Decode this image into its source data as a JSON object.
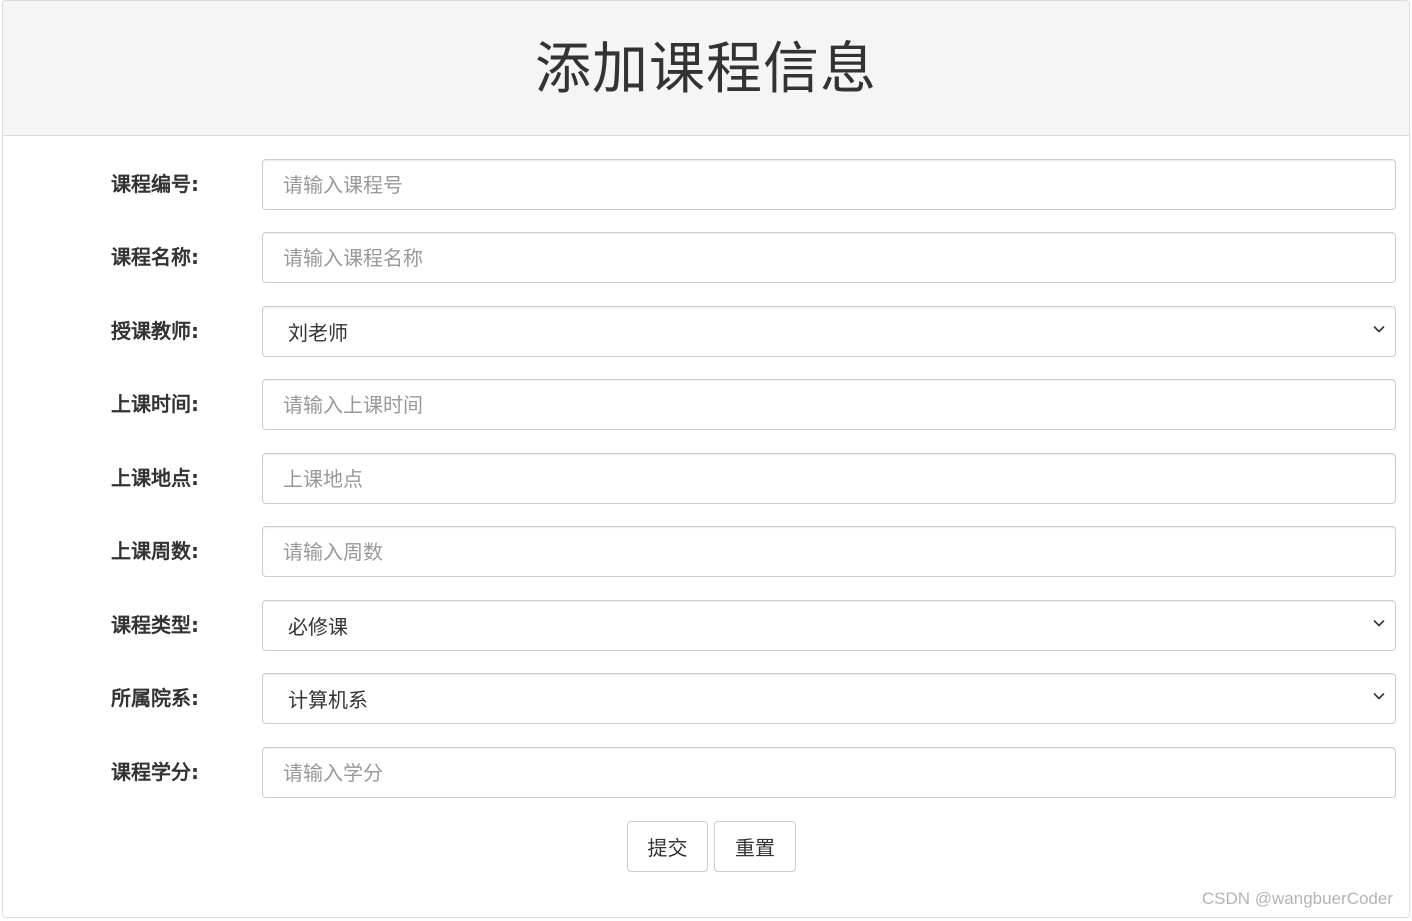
{
  "header": {
    "title": "添加课程信息"
  },
  "form": {
    "fields": [
      {
        "label": "课程编号:",
        "type": "input",
        "placeholder": "请输入课程号",
        "value": ""
      },
      {
        "label": "课程名称:",
        "type": "input",
        "placeholder": "请输入课程名称",
        "value": ""
      },
      {
        "label": "授课教师:",
        "type": "select",
        "value": "刘老师"
      },
      {
        "label": "上课时间:",
        "type": "input",
        "placeholder": "请输入上课时间",
        "value": ""
      },
      {
        "label": "上课地点:",
        "type": "input",
        "placeholder": "上课地点",
        "value": ""
      },
      {
        "label": "上课周数:",
        "type": "input",
        "placeholder": "请输入周数",
        "value": ""
      },
      {
        "label": "课程类型:",
        "type": "select",
        "value": "必修课"
      },
      {
        "label": "所属院系:",
        "type": "select",
        "value": "计算机系"
      },
      {
        "label": "课程学分:",
        "type": "input",
        "placeholder": "请输入学分",
        "value": ""
      }
    ],
    "submit_label": "提交",
    "reset_label": "重置"
  },
  "watermark": "CSDN @wangbuerCoder",
  "colors": {
    "heading_bg": "#f5f5f5",
    "border": "#cccccc",
    "label_text": "#333333",
    "placeholder_text": "#999999"
  }
}
